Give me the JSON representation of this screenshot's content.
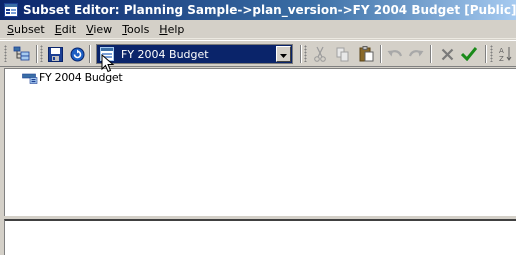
{
  "window": {
    "title": "Subset Editor:  Planning Sample->plan_version->FY 2004 Budget  [Public]"
  },
  "menu": {
    "items": [
      {
        "label": "Subset",
        "accel": "S",
        "rest": "ubset"
      },
      {
        "label": "Edit",
        "accel": "E",
        "rest": "dit"
      },
      {
        "label": "View",
        "accel": "V",
        "rest": "iew"
      },
      {
        "label": "Tools",
        "accel": "T",
        "rest": "ools"
      },
      {
        "label": "Help",
        "accel": "H",
        "rest": "elp"
      }
    ]
  },
  "toolbar": {
    "subset_combo_value": "FY 2004 Budget",
    "icons": [
      "subset-tree-icon",
      "save-icon",
      "refresh-icon",
      "cut-icon",
      "copy-icon",
      "paste-icon",
      "undo-icon",
      "redo-icon",
      "delete-icon",
      "ok-checkmark-icon",
      "sort-icon"
    ]
  },
  "tree": {
    "items": [
      {
        "label": "FY 2004 Budget",
        "icon": "element-node-icon"
      }
    ]
  },
  "colors": {
    "title_bar_start": "#0a246a",
    "title_bar_end": "#a6caf0",
    "chrome": "#d4d0c8",
    "selection": "#0a246a",
    "check_green": "#1a8a1a"
  }
}
